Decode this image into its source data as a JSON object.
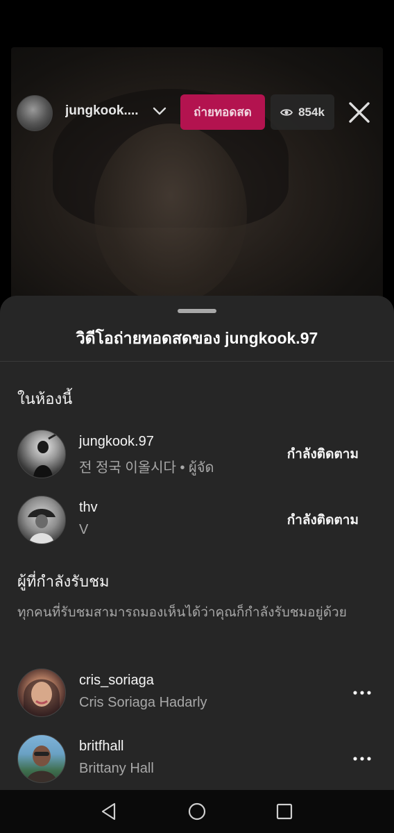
{
  "live": {
    "host_username": "jungkook....",
    "live_label": "ถ่ายทอดสด",
    "viewer_count": "854k"
  },
  "sheet": {
    "title": "วิดีโอถ่ายทอดสดของ jungkook.97",
    "in_room_heading": "ในห้องนี้",
    "in_room": [
      {
        "username": "jungkook.97",
        "subtitle": "전 정국 이올시다 • ผู้จัด",
        "action": "กำลังติดตาม"
      },
      {
        "username": "thv",
        "subtitle": "V",
        "action": "กำลังติดตาม"
      }
    ],
    "viewers_heading": "ผู้ที่กำลังรับชม",
    "viewers_description": "ทุกคนที่รับชมสามารถมองเห็นได้ว่าคุณก็กำลังรับชมอยู่ด้วย",
    "viewers": [
      {
        "username": "cris_soriaga",
        "subtitle": "Cris Soriaga Hadarly"
      },
      {
        "username": "britfhall",
        "subtitle": "Brittany Hall"
      }
    ]
  },
  "colors": {
    "live_badge": "#b3134f",
    "sheet_bg": "#262626",
    "secondary_text": "#a8a8a8"
  },
  "icons": [
    "chevron-down-icon",
    "eye-icon",
    "close-icon",
    "more-icon",
    "back-icon",
    "home-icon",
    "recents-icon"
  ]
}
